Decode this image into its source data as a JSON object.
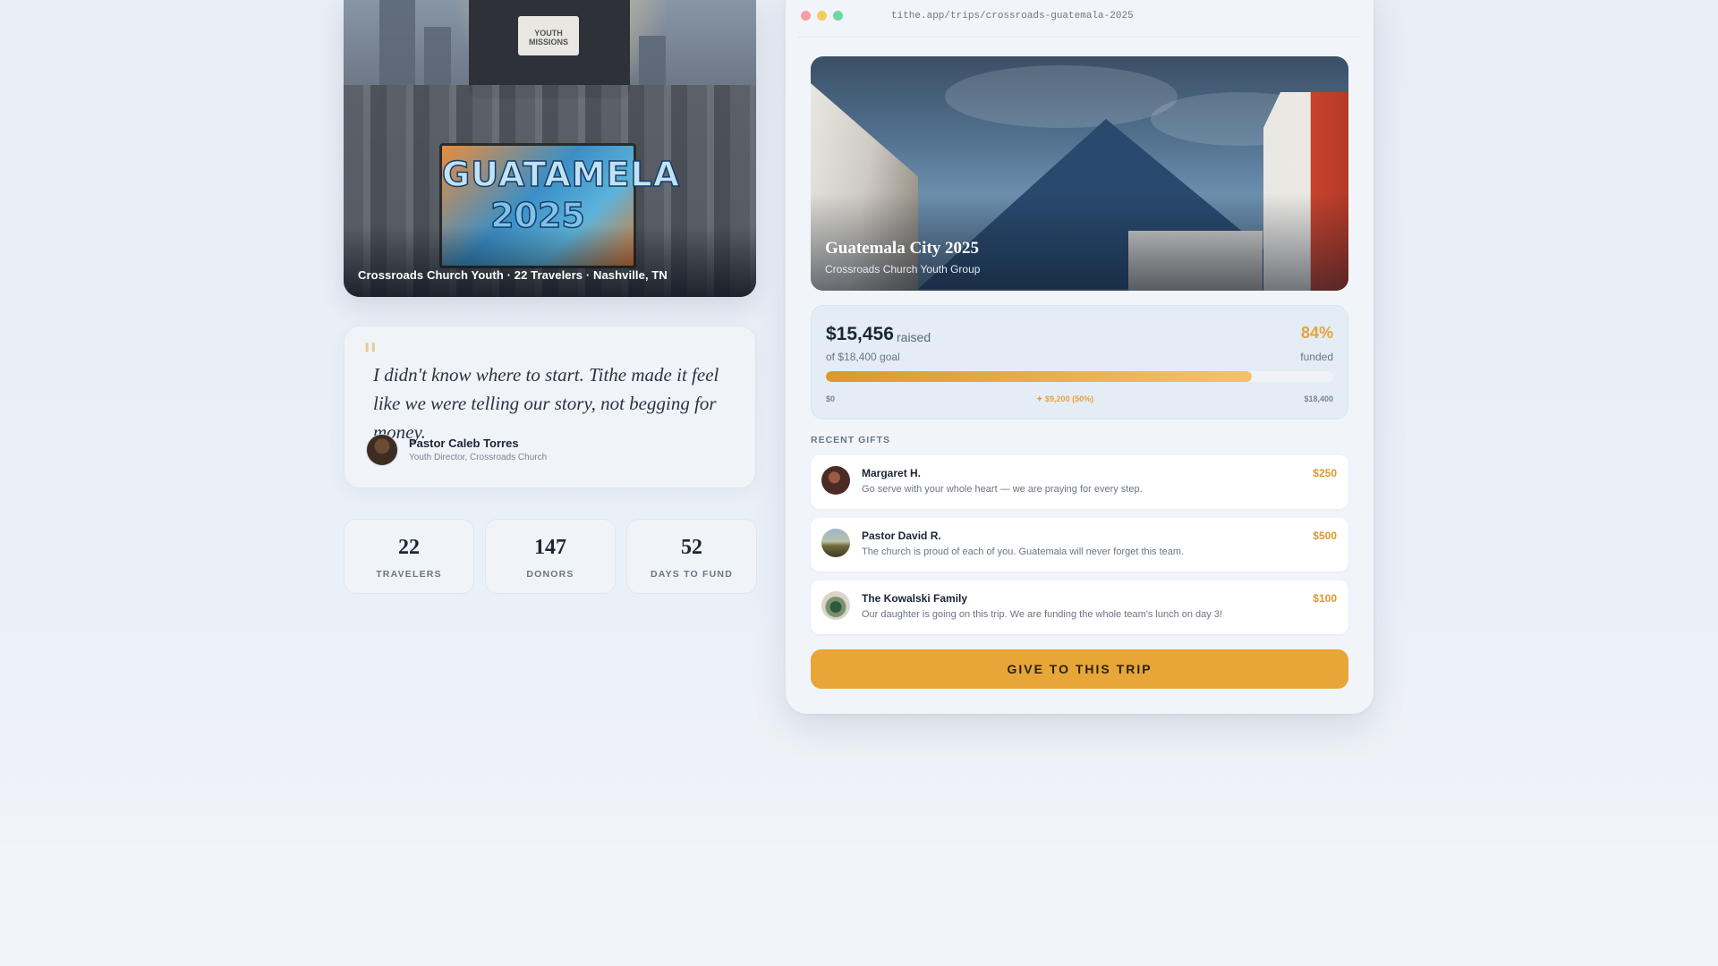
{
  "hero": {
    "caption": "Crossroads Church Youth · 22 Travelers · Nashville, TN",
    "bus_sign": "YOUTH MISSIONS",
    "banner_line1": "GUATAMELA",
    "banner_line2": "2025"
  },
  "testimonial": {
    "quote": "I didn't know where to start. Tithe made it feel like we were telling our story, not begging for money.",
    "author_name": "Pastor Caleb Torres",
    "author_role": "Youth Director, Crossroads Church"
  },
  "stats": [
    {
      "value": "22",
      "label": "TRAVELERS"
    },
    {
      "value": "147",
      "label": "DONORS"
    },
    {
      "value": "52",
      "label": "DAYS TO FUND"
    }
  ],
  "window": {
    "url": "tithe.app/trips/crossroads-guatemala-2025",
    "dot_colors": [
      "#f3a0a6",
      "#f5cc5c",
      "#6fd6a0"
    ]
  },
  "trip": {
    "title": "Guatemala City 2025",
    "subtitle": "Crossroads Church Youth Group"
  },
  "funding": {
    "raised": "$15,456",
    "raised_label": "raised",
    "goal_text": "of $18,400 goal",
    "percent": "84%",
    "percent_label": "funded",
    "progress_fraction": 0.84,
    "tick_start": "$0",
    "tick_mid": "✦ $9,200 (50%)",
    "tick_end": "$18,400",
    "accent_color": "#e7a637"
  },
  "recent": {
    "heading": "RECENT GIFTS",
    "gifts": [
      {
        "name": "Margaret H.",
        "message": "Go serve with your whole heart — we are praying for every step.",
        "amount": "$250"
      },
      {
        "name": "Pastor David R.",
        "message": "The church is proud of each of you. Guatemala will never forget this team.",
        "amount": "$500"
      },
      {
        "name": "The Kowalski Family",
        "message": "Our daughter is going on this trip. We are funding the whole team's lunch on day 3!",
        "amount": "$100"
      }
    ]
  },
  "cta": {
    "label": "GIVE TO THIS TRIP"
  }
}
